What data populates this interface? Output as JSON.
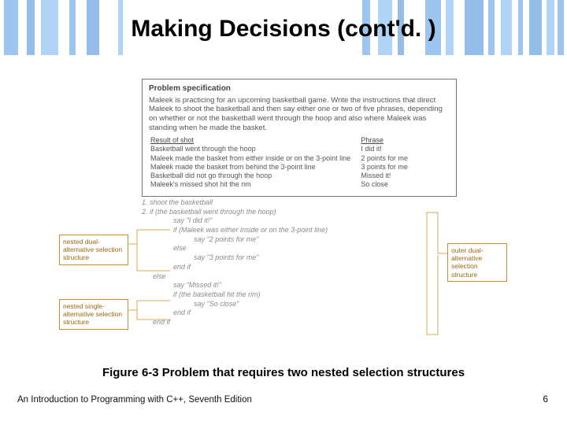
{
  "title": "Making Decisions (cont'd. )",
  "spec": {
    "heading": "Problem specification",
    "body": "Maleek is practicing for an upcoming basketball game. Write the instructions that direct Maleek to shoot the basketball and then say either one or two of five phrases, depending on whether or not the basketball went through the hoop and also where Maleek was standing when he made the basket.",
    "col_left": "Result of shot",
    "col_right": "Phrase",
    "rows": [
      {
        "l": "Basketball went through the hoop",
        "r": "I did it!"
      },
      {
        "l": "Maleek made the basket from either inside or on the 3-point line",
        "r": "2 points for me"
      },
      {
        "l": "Maleek made the basket from behind the 3-point line",
        "r": "3 points for me"
      },
      {
        "l": "Basketball did not go through the hoop",
        "r": "Missed it!"
      },
      {
        "l": "Maleek's missed shot hit the rim",
        "r": "So close"
      }
    ]
  },
  "pseudo": {
    "lines": [
      {
        "t": "1. shoot the basketball",
        "cls": ""
      },
      {
        "t": "2. if (the basketball went through the hoop)",
        "cls": ""
      },
      {
        "t": "say \"I did it!\"",
        "cls": "i2"
      },
      {
        "t": "if (Maleek was either inside or on the 3-point line)",
        "cls": "i2"
      },
      {
        "t": "say \"2 points for me\"",
        "cls": "i3"
      },
      {
        "t": "else",
        "cls": "i2"
      },
      {
        "t": "say \"3 points for me\"",
        "cls": "i3"
      },
      {
        "t": "end if",
        "cls": "i2"
      },
      {
        "t": "else",
        "cls": "i1"
      },
      {
        "t": "say \"Missed it!\"",
        "cls": "i2"
      },
      {
        "t": "if (the basketball hit the rim)",
        "cls": "i2"
      },
      {
        "t": "say \"So close\"",
        "cls": "i3"
      },
      {
        "t": "end if",
        "cls": "i2"
      },
      {
        "t": "end if",
        "cls": "i1"
      }
    ]
  },
  "annotations": {
    "left1": "nested dual-alternative selection structure",
    "left2": "nested single-alternative selection structure",
    "right1": "outer dual-alternative selection structure"
  },
  "caption": "Figure 6-3 Problem that requires two nested selection structures",
  "footer_left": "An Introduction to Programming with C++, Seventh Edition",
  "footer_right": "6"
}
